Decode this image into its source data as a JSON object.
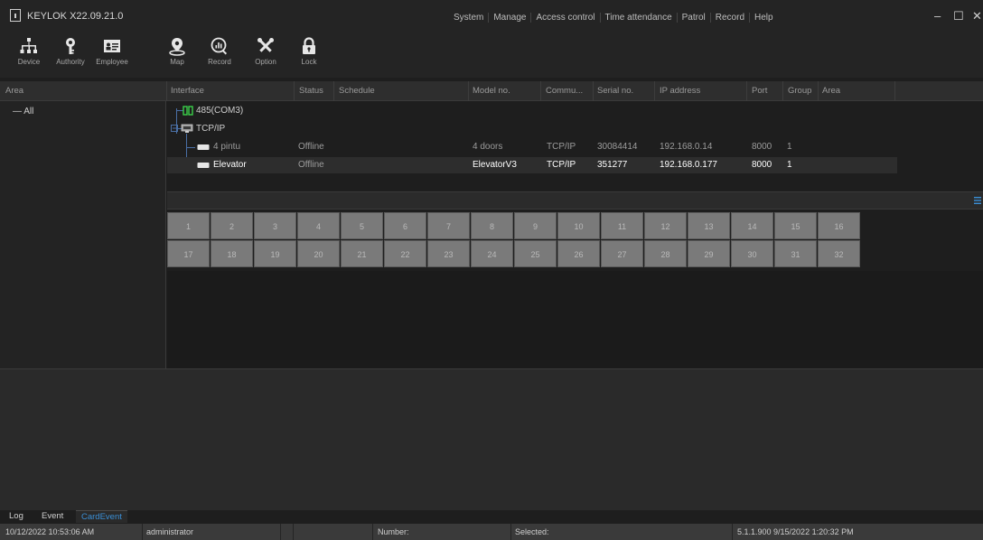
{
  "app": {
    "title": "KEYLOK X22.09.21.0"
  },
  "menu": [
    "System",
    "Manage",
    "Access control",
    "Time attendance",
    "Patrol",
    "Record",
    "Help"
  ],
  "window_controls": {
    "minimize": "–",
    "maximize": "☐",
    "close": "✕"
  },
  "toolbar": [
    {
      "label": "Device",
      "icon": "device-tree-icon"
    },
    {
      "label": "Authority",
      "icon": "key-icon"
    },
    {
      "label": "Employee",
      "icon": "id-card-icon"
    },
    {
      "label": "Map",
      "icon": "map-pin-icon"
    },
    {
      "label": "Record",
      "icon": "record-chart-icon"
    },
    {
      "label": "Option",
      "icon": "tools-icon"
    },
    {
      "label": "Lock",
      "icon": "lock-icon"
    }
  ],
  "columns": [
    "Area",
    "Interface",
    "Status",
    "Schedule",
    "Model no.",
    "Commu...",
    "Serial no.",
    "IP address",
    "Port",
    "Group",
    "Area"
  ],
  "area_tree": {
    "root": "— All"
  },
  "device_tree": {
    "port_485": "485(COM3)",
    "tcpip": "TCP/IP",
    "devices": [
      {
        "name": "4 pintu",
        "status": "Offline",
        "model": "4 doors",
        "comm": "TCP/IP",
        "serial": "30084414",
        "ip": "192.168.0.14",
        "port": "8000",
        "group": "1",
        "selected": false
      },
      {
        "name": "Elevator",
        "status": "Offline",
        "model": "ElevatorV3",
        "comm": "TCP/IP",
        "serial": "351277",
        "ip": "192.168.0.177",
        "port": "8000",
        "group": "1",
        "selected": true
      }
    ]
  },
  "doors": [
    "1",
    "2",
    "3",
    "4",
    "5",
    "6",
    "7",
    "8",
    "9",
    "10",
    "11",
    "12",
    "13",
    "14",
    "15",
    "16",
    "17",
    "18",
    "19",
    "20",
    "21",
    "22",
    "23",
    "24",
    "25",
    "26",
    "27",
    "28",
    "29",
    "30",
    "31",
    "32"
  ],
  "tabs": [
    {
      "label": "Log",
      "active": false
    },
    {
      "label": "Event",
      "active": false
    },
    {
      "label": "CardEvent",
      "active": true
    }
  ],
  "statusbar": {
    "datetime": "10/12/2022 10:53:06 AM",
    "user": "administrator",
    "number": "Number:",
    "selected": "Selected:",
    "version": "5.1.1.900  9/15/2022 1:20:32 PM"
  },
  "colors": {
    "background": "#1e1e1e",
    "active_tab": "#3a8fd6",
    "tree_line": "#4a6fa5",
    "door_button": "#7a7a7a"
  }
}
